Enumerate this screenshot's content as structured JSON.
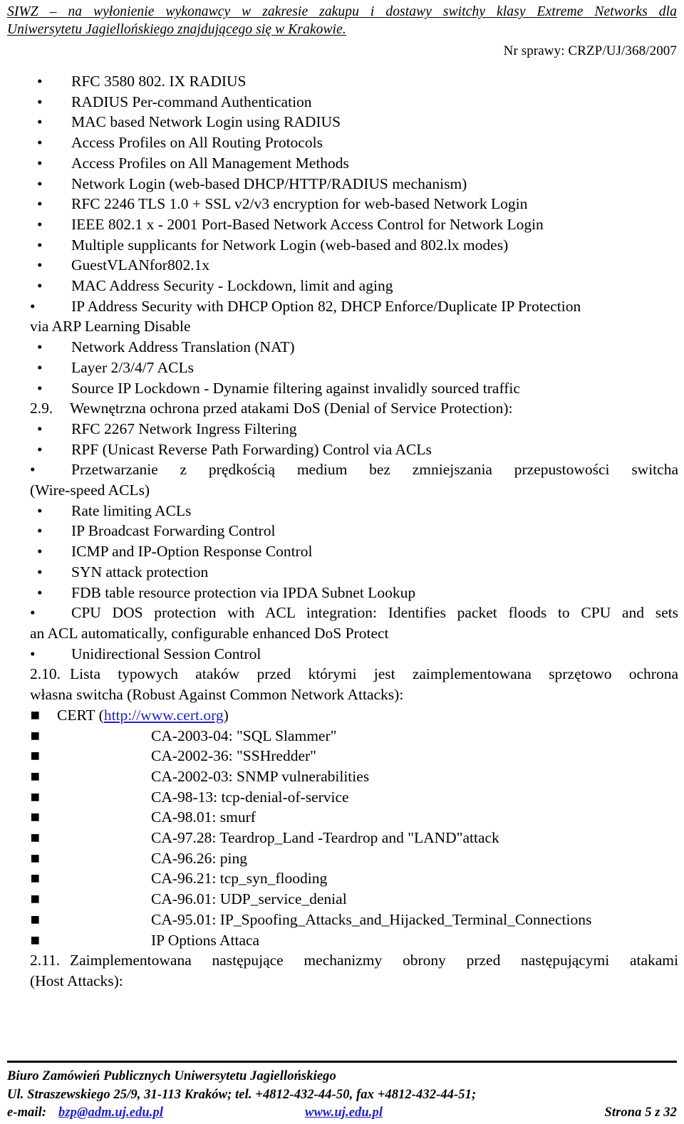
{
  "header": {
    "title_line1": "SIWZ – na wyłonienie wykonawcy w zakresie zakupu i dostawy switchy klasy Extreme Networks dla",
    "title_line2": "Uniwersytetu Jagiellońskiego znajdującego się w Krakowie.",
    "case_number": "Nr sprawy: CRZP/UJ/368/2007"
  },
  "content": {
    "bullets_security": [
      "RFC 3580 802. IX RADIUS",
      "RADIUS Per-command Authentication",
      "MAC based Network Login using RADIUS",
      "Access Profiles on All Routing Protocols",
      "Access Profiles on All Management Methods",
      "Network Login (web-based DHCP/HTTP/RADIUS mechanism)",
      "RFC 2246 TLS 1.0 + SSL v2/v3 encryption for web-based Network Login",
      "IEEE 802.1 x - 2001 Port-Based Network Access Control for Network Login",
      "Multiple supplicants for Network Login (web-based and 802.lx modes)",
      "GuestVLANfor802.1x",
      "MAC Address Security - Lockdown, limit and aging"
    ],
    "bullet_ip_address_security": "IP Address Security with DHCP Option 82, DHCP Enforce/Duplicate IP Protection",
    "bullet_ip_address_security_cont": "via ARP Learning Disable",
    "bullets_security_tail": [
      "Network Address Translation (NAT)",
      "Layer 2/3/4/7 ACLs",
      "Source IP Lockdown - Dynamie filtering against invalidly sourced traffic"
    ],
    "section_29_num": "2.9.",
    "section_29_text": "Wewnętrzna ochrona przed atakami DoS (Denial of Service Protection):",
    "bullets_dos_a": [
      "RFC 2267 Network Ingress Filtering",
      "RPF (Unicast Reverse Path Forwarding) Control via ACLs"
    ],
    "bullet_wirespeed": "Przetwarzanie z prędkością medium bez zmniejszania przepustowości switcha",
    "bullet_wirespeed_cont": "(Wire-speed ACLs)",
    "bullets_dos_b": [
      "Rate limiting ACLs",
      "IP Broadcast Forwarding Control",
      "ICMP and IP-Option Response Control",
      "SYN attack protection",
      "FDB table resource protection via IPDA Subnet Lookup"
    ],
    "bullet_cpu_dos": "CPU DOS protection with ACL integration: Identifies packet floods to CPU and sets",
    "bullet_cpu_dos_cont": "an ACL automatically, configurable enhanced DoS Protect",
    "bullet_unidirectional": "Unidirectional Session Control",
    "section_210_num": "2.10.",
    "section_210_text": "Lista typowych ataków przed którymi jest zaimplementowana sprzętowo ochrona",
    "section_210_text_cont": "własna switcha (Robust Against Common Network Attacks):",
    "cert_label": "CERT (",
    "cert_link": "http://www.cert.org",
    "cert_label_end": ")",
    "cert_items": [
      "CA-2003-04: \"SQL Slammer\"",
      "CA-2002-36: \"SSHredder\"",
      "CA-2002-03: SNMP vulnerabilities",
      "CA-98-13: tcp-denial-of-service",
      "CA-98.01: smurf",
      "CA-97.28: Teardrop_Land -Teardrop and \"LAND\"attack",
      "CA-96.26: ping",
      "CA-96.21: tcp_syn_flooding",
      "CA-96.01: UDP_service_denial",
      "CA-95.01: IP_Spoofing_Attacks_and_Hijacked_Terminal_Connections",
      "IP Options Attaca"
    ],
    "section_211_num": "2.11.",
    "section_211_text": "Zaimplementowana następujące mechanizmy obrony przed następującymi atakami",
    "section_211_text_cont": "(Host Attacks):",
    "bullet_glyph": "•",
    "square_glyph": "▪"
  },
  "footer": {
    "line1": "Biuro Zamówień Publicznych Uniwersytetu Jagiellońskiego",
    "line2": "Ul. Straszewskiego 25/9, 31-113 Kraków; tel. +4812-432-44-50, fax +4812-432-44-51;",
    "email_label": "e-mail:",
    "email": "bzp@adm.uj.edu.pl",
    "website": "www.uj.edu.pl",
    "page": "Strona 5 z 32"
  },
  "colors": {
    "link": "#1f1fc8",
    "text": "#000000",
    "background": "#ffffff"
  }
}
